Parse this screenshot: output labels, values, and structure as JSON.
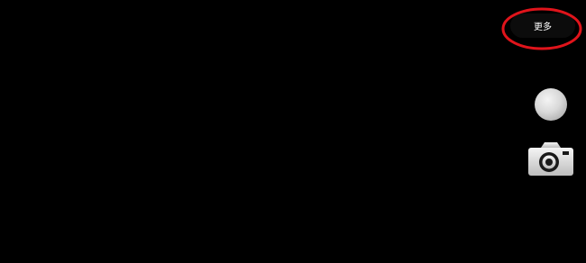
{
  "app": {
    "more_label": "更多"
  },
  "colors": {
    "background": "#000000",
    "annotation": "#e0141b",
    "button_text": "#ffffff"
  },
  "icons": {
    "shutter": "shutter-circle",
    "camera": "camera-icon"
  }
}
